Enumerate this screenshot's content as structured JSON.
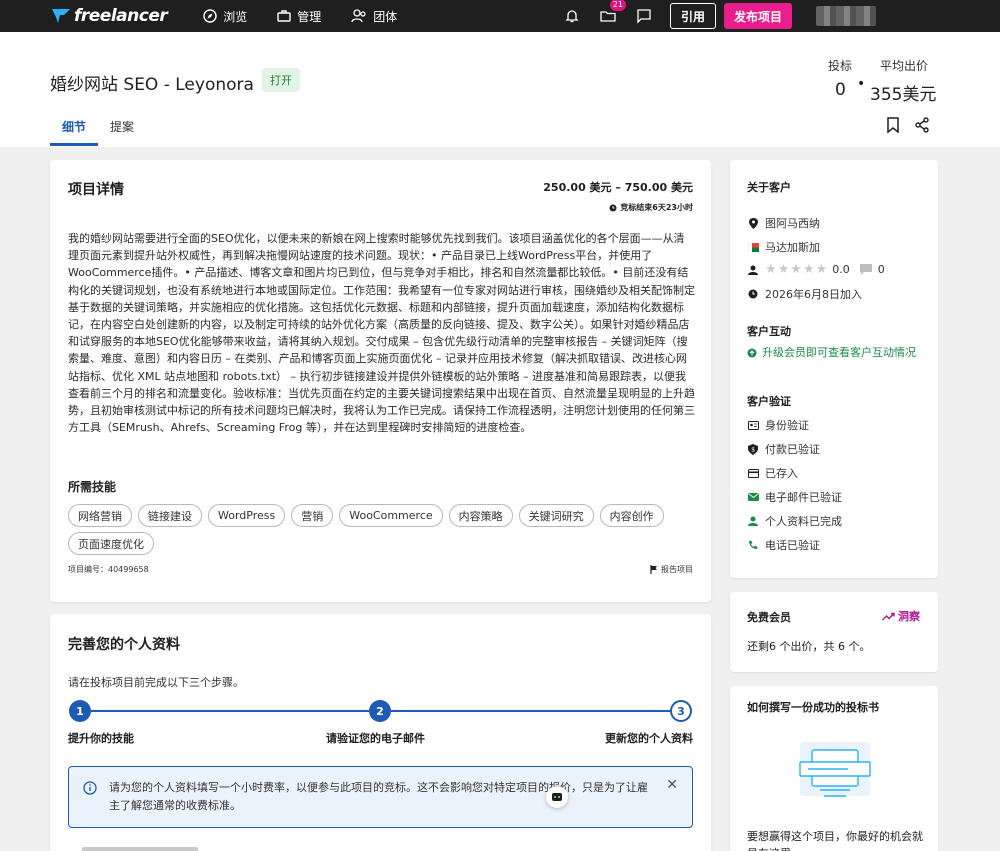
{
  "nav": {
    "logo": "freelancer",
    "browse": "浏览",
    "manage": "管理",
    "groups": "团体",
    "file_badge": "21",
    "cite_btn": "引用",
    "post_btn": "发布项目"
  },
  "header": {
    "title": "婚纱网站 SEO - Leyonora",
    "status": "打开",
    "bids_label": "投标",
    "avg_label": "平均出价",
    "bids_value": "0",
    "avg_value": "355美元",
    "tabs": [
      {
        "label": "细节"
      },
      {
        "label": "提案"
      }
    ]
  },
  "project": {
    "title": "项目详情",
    "budget": "250.00 美元 – 750.00 美元",
    "deadline": "竞标结束6天23小时",
    "description": "我的婚纱网站需要进行全面的SEO优化，以便未来的新娘在网上搜索时能够优先找到我们。该项目涵盖优化的各个层面——从清理页面元素到提升站外权威性，再到解决拖慢网站速度的技术问题。现状：• 产品目录已上线WordPress平台，并使用了WooCommerce插件。• 产品描述、博客文章和图片均已到位，但与竞争对手相比，排名和自然流量都比较低。• 目前还没有结构化的关键词规划，也没有系统地进行本地或国际定位。工作范围：我希望有一位专家对网站进行审核，围绕婚纱及相关配饰制定基于数据的关键词策略，并实施相应的优化措施。这包括优化元数据、标题和内部链接，提升页面加载速度，添加结构化数据标记，在内容空白处创建新的内容，以及制定可持续的站外优化方案（高质量的反向链接、提及、数字公关）。如果针对婚纱精品店和试穿服务的本地SEO优化能够带来收益，请将其纳入规划。交付成果 – 包含优先级行动清单的完整审核报告 – 关键词矩阵（搜索量、难度、意图）和内容日历 – 在类别、产品和博客页面上实施页面优化 – 记录并应用技术修复（解决抓取错误、改进核心网站指标、优化 XML 站点地图和 robots.txt） – 执行初步链接建设并提供外链模板的站外策略 – 进度基准和简易跟踪表，以便我查看前三个月的排名和流量变化。验收标准：当优先页面在约定的主要关键词搜索结果中出现在首页、自然流量呈现明显的上升趋势，且初始审核测试中标记的所有技术问题均已解决时，我将认为工作已完成。请保持工作流程透明，注明您计划使用的任何第三方工具（SEMrush、Ahrefs、Screaming Frog 等），并在达到里程碑时安排简短的进度检查。",
    "skills_title": "所需技能",
    "skills": [
      "网络营销",
      "链接建设",
      "WordPress",
      "营销",
      "WooCommerce",
      "内容策略",
      "关键词研究",
      "内容创作",
      "页面速度优化"
    ],
    "project_id": "项目编号：40499658",
    "report": "报告项目"
  },
  "profile": {
    "title": "完善您的个人资料",
    "intro": "请在投标项目前完成以下三个步骤。",
    "steps": [
      {
        "num": "1",
        "label": "提升你的技能"
      },
      {
        "num": "2",
        "label": "请验证您的电子邮件"
      },
      {
        "num": "3",
        "label": "更新您的个人资料"
      }
    ],
    "info": "请为您的个人资料填写一个小时费率，以便参与此项目的竞标。这不会影响您对特定项目的报价，只是为了让雇主了解您通常的收费标准。"
  },
  "client": {
    "title": "关于客户",
    "city": "图阿马西纳",
    "country": "马达加斯加",
    "rating": "0.0",
    "reviews": "0",
    "joined": "2026年6月8日加入",
    "interaction_title": "客户互动",
    "interaction_link": "升级会员即可查看客户互动情况",
    "verification_title": "客户验证",
    "verifications": [
      "身份验证",
      "付款已验证",
      "已存入",
      "电子邮件已验证",
      "个人资料已完成",
      "电话已验证"
    ]
  },
  "membership": {
    "title": "免费会员",
    "insight": "洞察",
    "remaining": "还剩6 个出价，共 6 个。"
  },
  "tips": {
    "title": "如何撰写一份成功的投标书",
    "text": "要想赢得这个项目，你最好的机会就是在这里..."
  }
}
